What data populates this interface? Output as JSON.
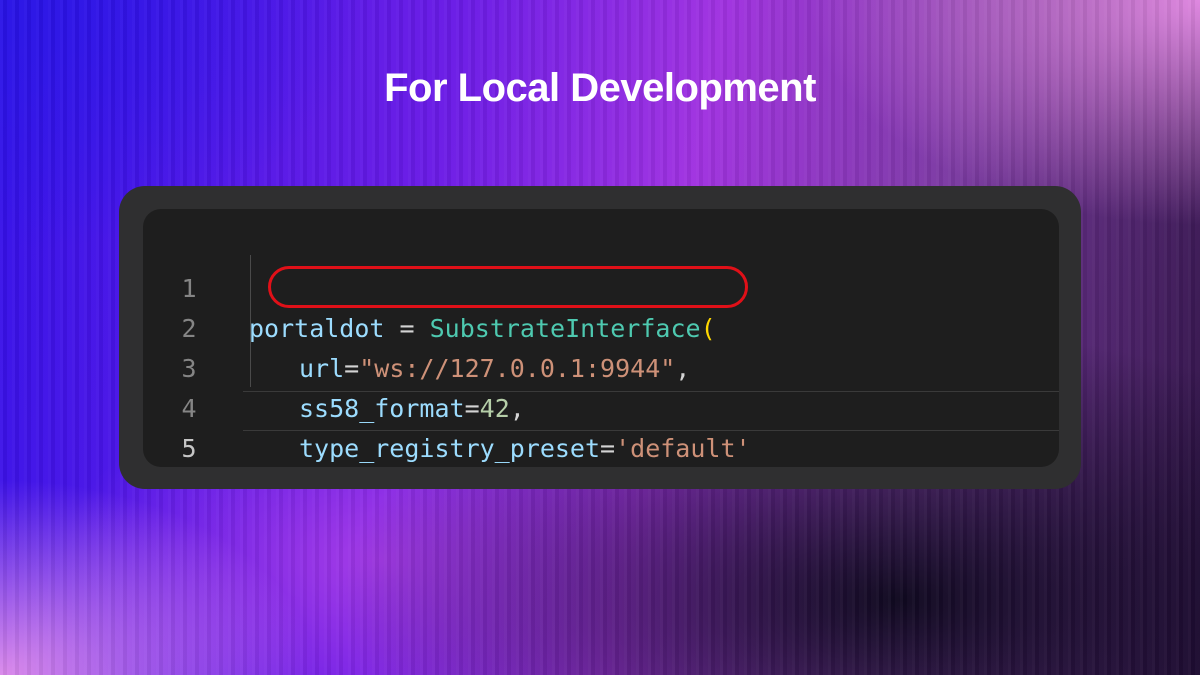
{
  "title": "For Local Development",
  "code": {
    "lines": [
      {
        "number": "1",
        "tokens": [
          "portaldot",
          " = ",
          "SubstrateInterface",
          "("
        ]
      },
      {
        "number": "2",
        "tokens": [
          "url",
          "=",
          "\"ws://127.0.0.1:9944\"",
          ","
        ]
      },
      {
        "number": "3",
        "tokens": [
          "ss58_format",
          "=",
          "42",
          ","
        ]
      },
      {
        "number": "4",
        "tokens": [
          "type_registry_preset",
          "=",
          "'default'"
        ]
      },
      {
        "number": "5",
        "tokens": [
          ")"
        ]
      }
    ]
  },
  "colors": {
    "editor_bg": "#1e1e1e",
    "frame_bg": "#2f2f30",
    "highlight": "#e01018",
    "string": "#ce9178",
    "number": "#b5cea8",
    "variable": "#9cdcfe",
    "bracket": "#ffd700"
  }
}
